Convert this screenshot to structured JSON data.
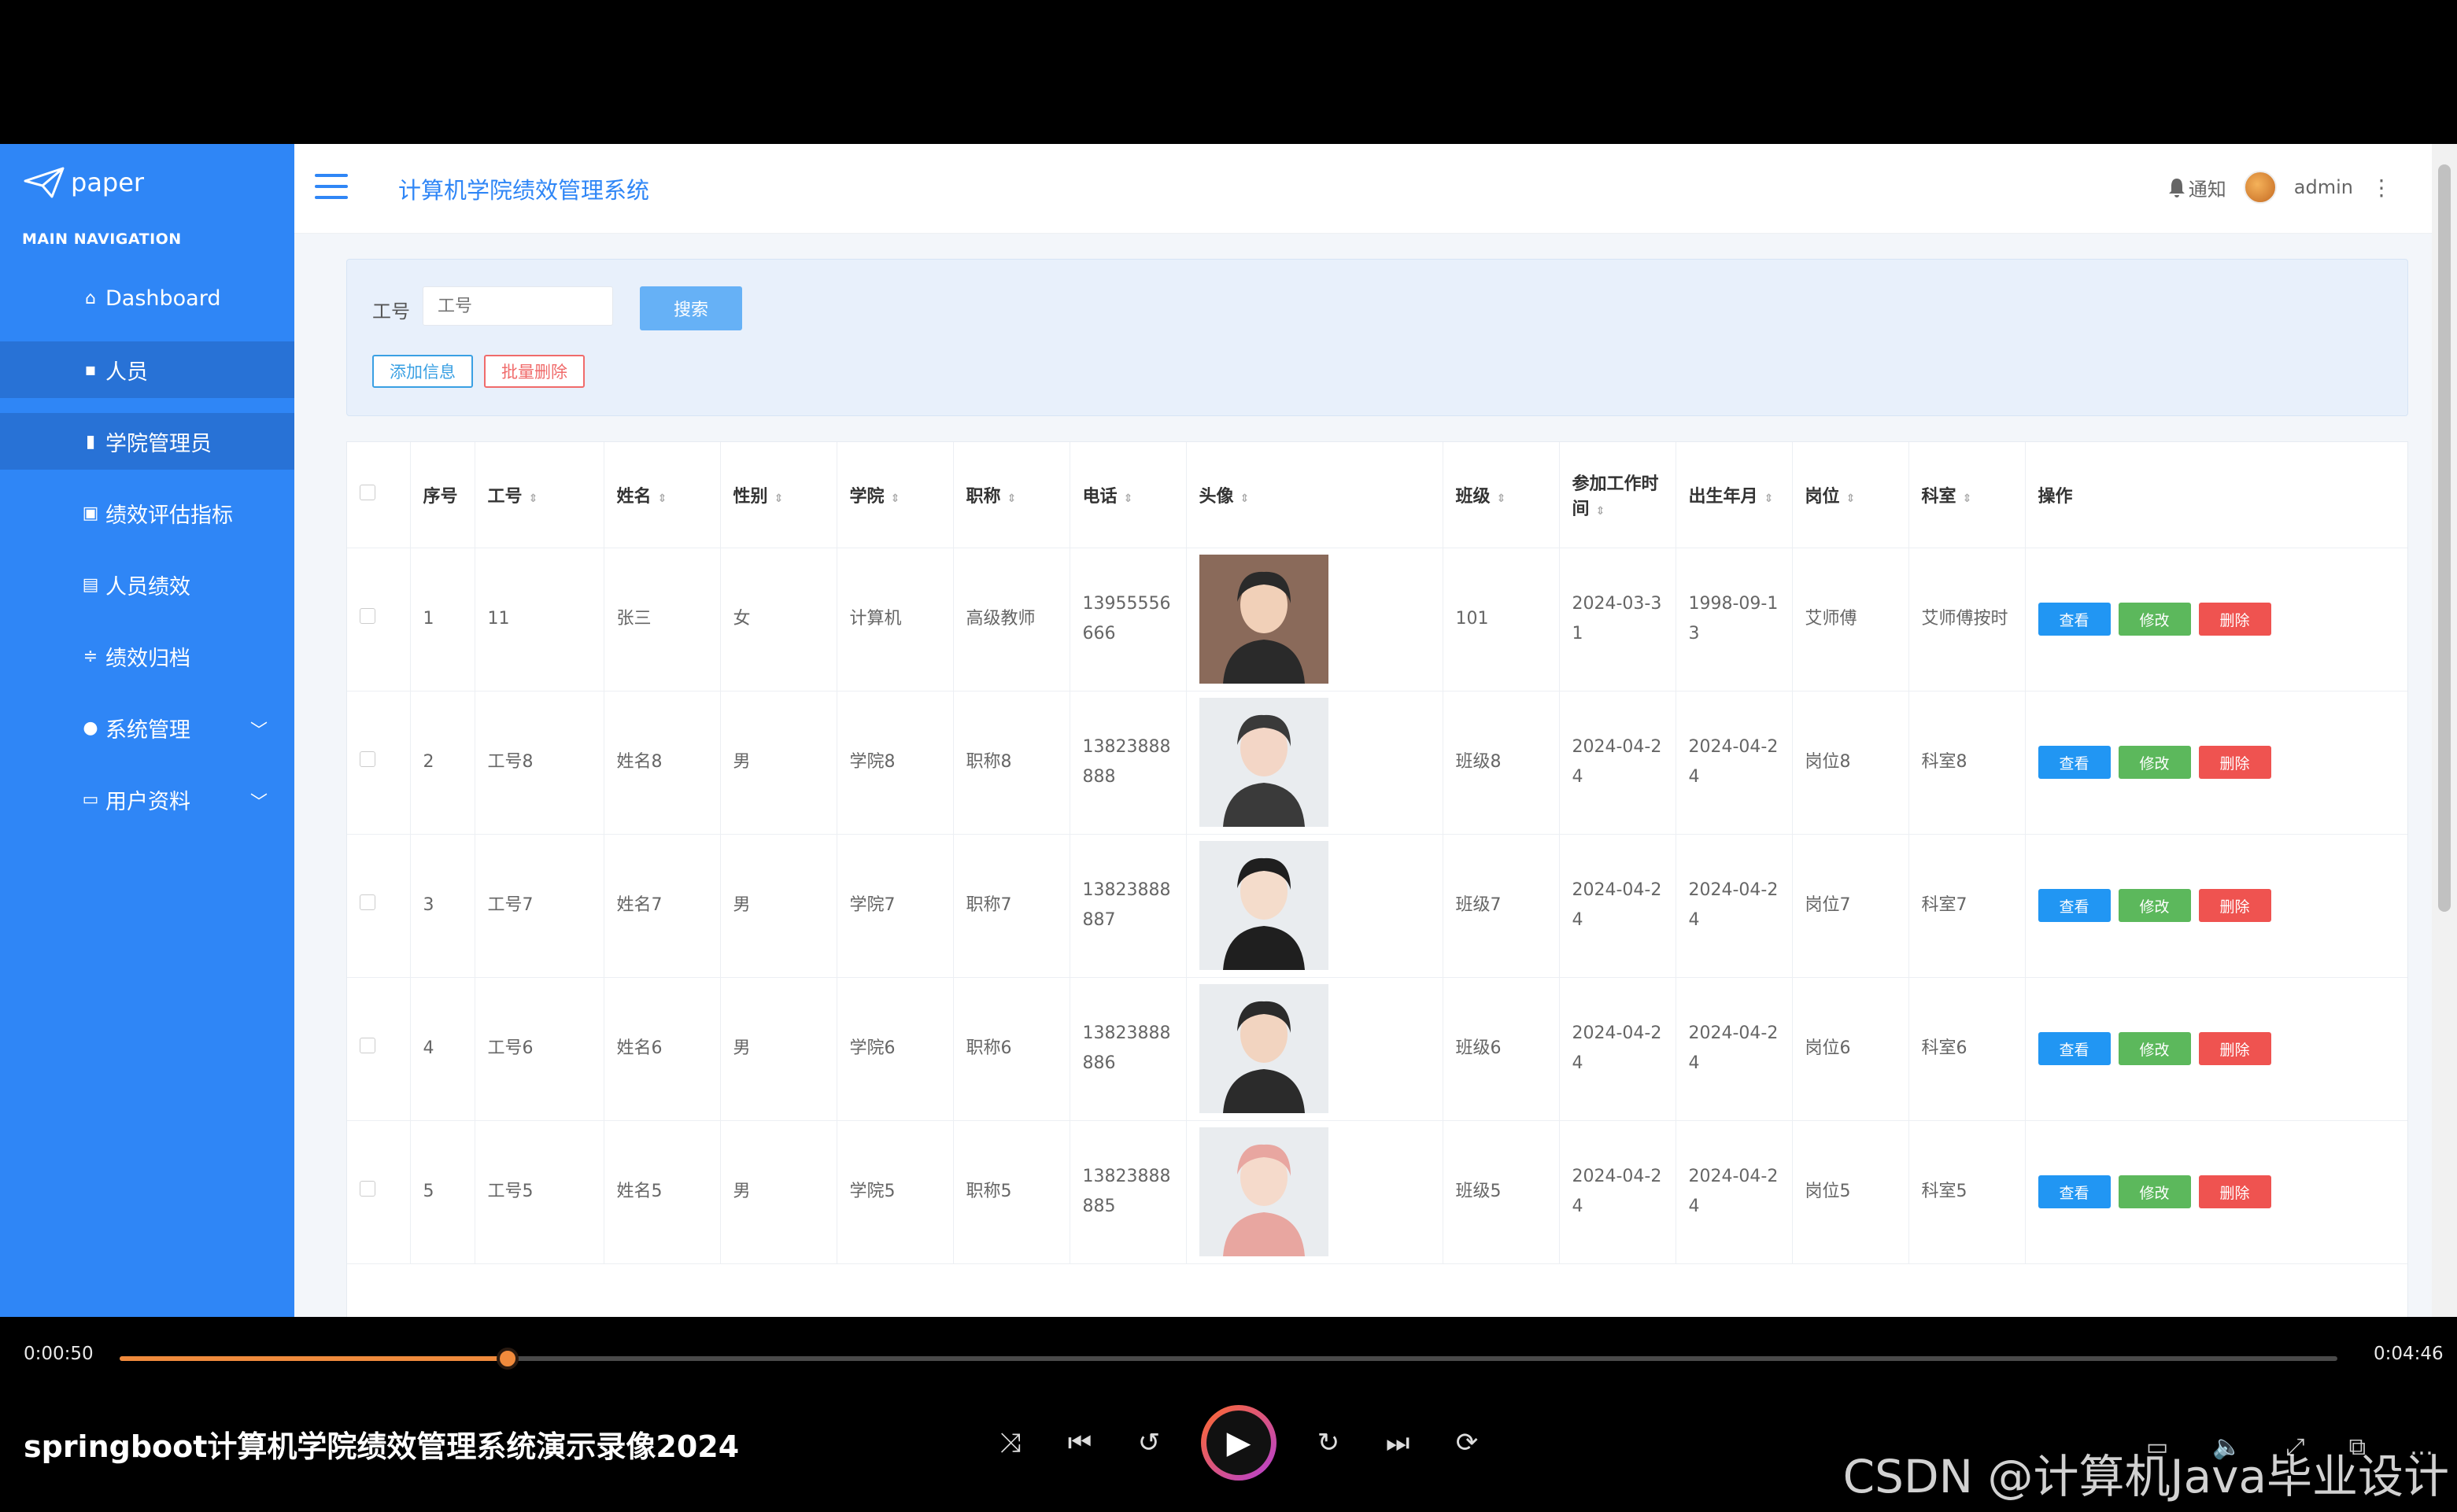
{
  "logo": {
    "text": "paper"
  },
  "nav": {
    "heading": "MAIN NAVIGATION",
    "items": [
      {
        "label": "Dashboard",
        "icon": "home-icon"
      },
      {
        "label": "人员",
        "icon": "book-icon"
      },
      {
        "label": "学院管理员",
        "icon": "bar-chart-icon"
      },
      {
        "label": "绩效评估指标",
        "icon": "checkbox-icon"
      },
      {
        "label": "人员绩效",
        "icon": "clipboard-icon"
      },
      {
        "label": "绩效归档",
        "icon": "sliders-icon"
      },
      {
        "label": "系统管理",
        "icon": "user-icon"
      },
      {
        "label": "用户资料",
        "icon": "calendar-icon"
      }
    ]
  },
  "header": {
    "title": "计算机学院绩效管理系统",
    "notify": "通知",
    "user": "admin"
  },
  "search": {
    "label": "工号",
    "placeholder": "工号",
    "button": "搜索",
    "add": "添加信息",
    "bulk_delete": "批量删除"
  },
  "table": {
    "headers": [
      "序号",
      "工号",
      "姓名",
      "性别",
      "学院",
      "职称",
      "电话",
      "头像",
      "班级",
      "参加工作时间",
      "出生年月",
      "岗位",
      "科室",
      "操作"
    ],
    "rows": [
      {
        "no": "1",
        "id": "11",
        "name": "张三",
        "gender": "女",
        "college": "计算机",
        "title": "高级教师",
        "phone": "13955556666",
        "cls": "101",
        "work": "2024-03-31",
        "birth": "1998-09-13",
        "post": "艾师傅",
        "dept": "艾师傅按时"
      },
      {
        "no": "2",
        "id": "工号8",
        "name": "姓名8",
        "gender": "男",
        "college": "学院8",
        "title": "职称8",
        "phone": "13823888888",
        "cls": "班级8",
        "work": "2024-04-24",
        "birth": "2024-04-24",
        "post": "岗位8",
        "dept": "科室8"
      },
      {
        "no": "3",
        "id": "工号7",
        "name": "姓名7",
        "gender": "男",
        "college": "学院7",
        "title": "职称7",
        "phone": "13823888887",
        "cls": "班级7",
        "work": "2024-04-24",
        "birth": "2024-04-24",
        "post": "岗位7",
        "dept": "科室7"
      },
      {
        "no": "4",
        "id": "工号6",
        "name": "姓名6",
        "gender": "男",
        "college": "学院6",
        "title": "职称6",
        "phone": "13823888886",
        "cls": "班级6",
        "work": "2024-04-24",
        "birth": "2024-04-24",
        "post": "岗位6",
        "dept": "科室6"
      },
      {
        "no": "5",
        "id": "工号5",
        "name": "姓名5",
        "gender": "男",
        "college": "学院5",
        "title": "职称5",
        "phone": "13823888885",
        "cls": "班级5",
        "work": "2024-04-24",
        "birth": "2024-04-24",
        "post": "岗位5",
        "dept": "科室5"
      }
    ],
    "ops": {
      "view": "查看",
      "edit": "修改",
      "delete": "删除"
    }
  },
  "player": {
    "current": "0:00:50",
    "duration": "0:04:46",
    "progress": 0.1748,
    "title": "springboot计算机学院绩效管理系统演示录像2024",
    "watermark": "CSDN @计算机Java毕业设计"
  }
}
